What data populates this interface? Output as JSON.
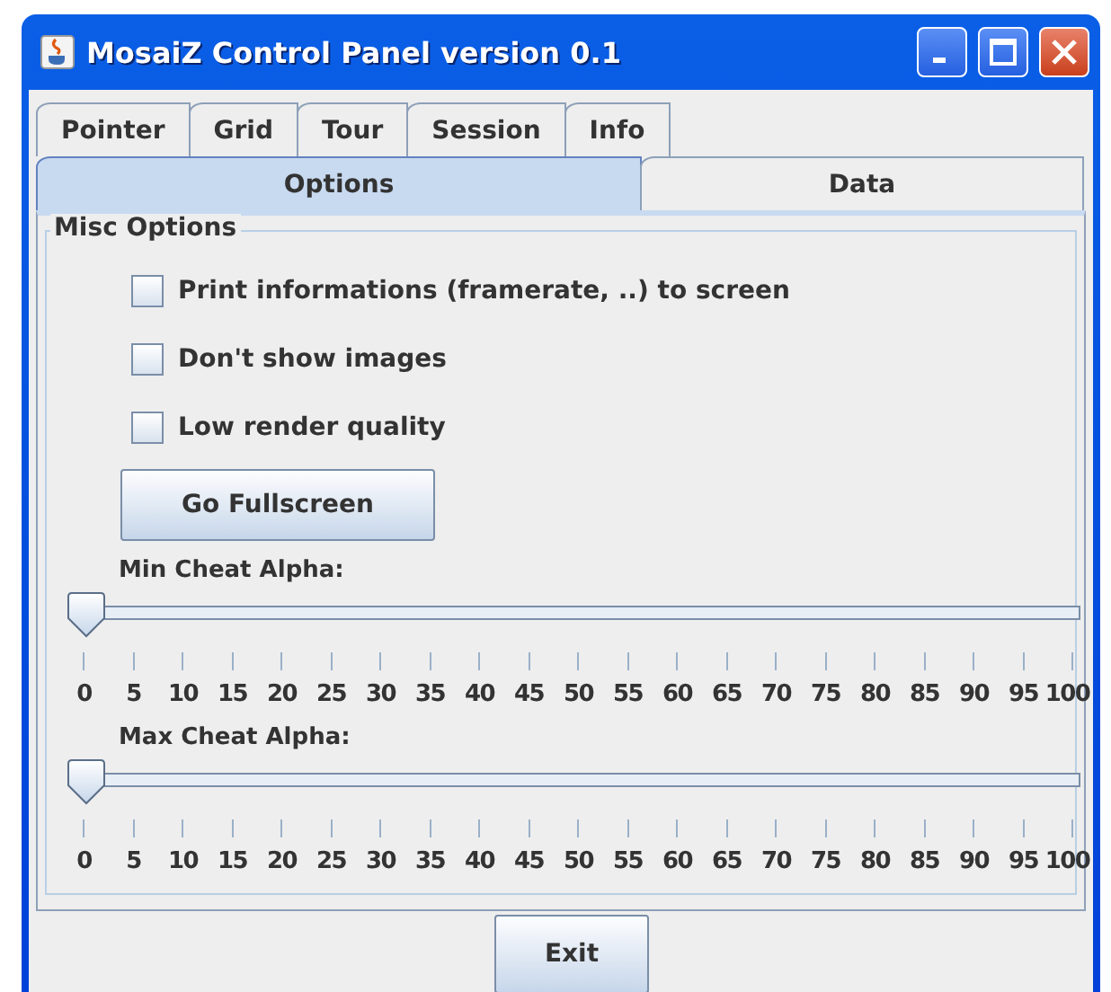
{
  "window": {
    "title": "MosaiZ Control Panel version 0.1"
  },
  "tab_rows": [
    [
      {
        "label": "Pointer",
        "selected": false
      },
      {
        "label": "Grid",
        "selected": false
      },
      {
        "label": "Tour",
        "selected": false
      },
      {
        "label": "Session",
        "selected": false
      },
      {
        "label": "Info",
        "selected": false
      }
    ],
    [
      {
        "label": "Options",
        "selected": true
      },
      {
        "label": "Data",
        "selected": false
      }
    ]
  ],
  "group": {
    "title": "Misc Options",
    "checkboxes": [
      {
        "label": "Print informations (framerate, ..) to screen",
        "checked": false
      },
      {
        "label": "Don't show images",
        "checked": false
      },
      {
        "label": "Low render quality",
        "checked": false
      }
    ],
    "button": "Go Fullscreen",
    "sliders": [
      {
        "label": "Min Cheat Alpha:",
        "level": 0,
        "ticks": [
          "0",
          "5",
          "10",
          "15",
          "20",
          "25",
          "30",
          "35",
          "40",
          "45",
          "50",
          "55",
          "60",
          "65",
          "70",
          "75",
          "80",
          "85",
          "90",
          "95",
          "100"
        ]
      },
      {
        "label": "Max Cheat Alpha:",
        "level": 0,
        "ticks": [
          "0",
          "5",
          "10",
          "15",
          "20",
          "25",
          "30",
          "35",
          "40",
          "45",
          "50",
          "55",
          "60",
          "65",
          "70",
          "75",
          "80",
          "85",
          "90",
          "95",
          "100"
        ]
      }
    ]
  },
  "buttons": [
    "Exit"
  ]
}
